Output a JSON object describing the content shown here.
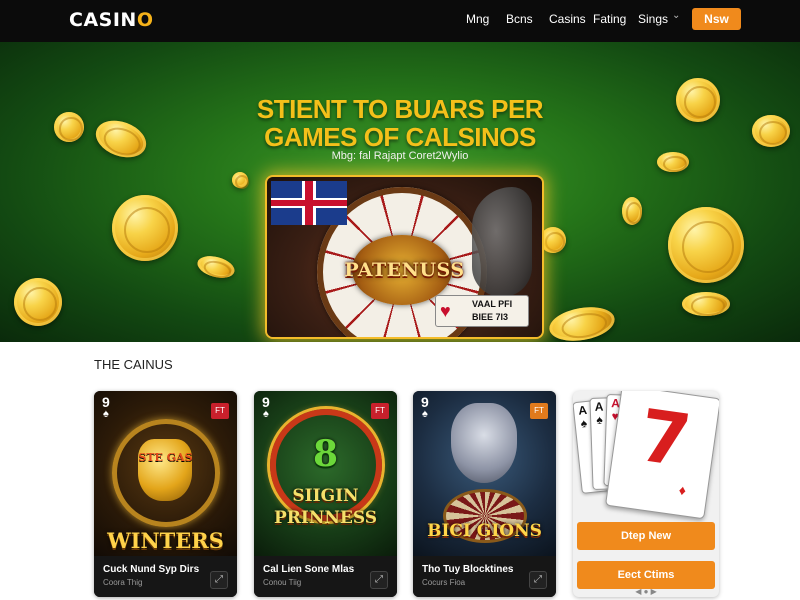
{
  "nav": {
    "logo_main": "CASIN",
    "logo_accent": "O",
    "links": [
      "Mng",
      "Bcns",
      "Casins",
      "Fating",
      "Sings"
    ],
    "cta": "Nsw"
  },
  "hero": {
    "title_line1": "STIENT TO BUARS PER",
    "title_line2": "GAMES OF CALSINOS",
    "subtitle": "Mbg: fal Rajapt Coret2Wylio",
    "feature_title": "PATENUSS",
    "feature_card_text": "VAAL PFI BIEE 7I3"
  },
  "section": {
    "title": "THE CAINUS"
  },
  "cards": [
    {
      "rank": "9",
      "badge": "FT",
      "art_label": "WINTERS",
      "art_top": "STE      GAS",
      "name": "Cuck Nund Syp Dirs",
      "sub": "Coora Thig"
    },
    {
      "rank": "9",
      "badge": "FT",
      "art_label": "SIIGIN PRINNESS",
      "art_top": "8",
      "name": "Cal Lien Sone Mlas",
      "sub": "Conou Tiig"
    },
    {
      "rank": "9",
      "badge": "FT",
      "art_label": "BICI GIONS",
      "art_top": "",
      "name": "Tho Tuy Blocktines",
      "sub": "Cocurs Fioa"
    }
  ],
  "side_card": {
    "buttons": [
      "Dtep New",
      "Eect Ctims"
    ],
    "pager": "◀ ● ▶"
  },
  "colors": {
    "accent": "#f08a1c",
    "gold": "#f4c01a",
    "nav_bg": "#0b0b0b"
  }
}
